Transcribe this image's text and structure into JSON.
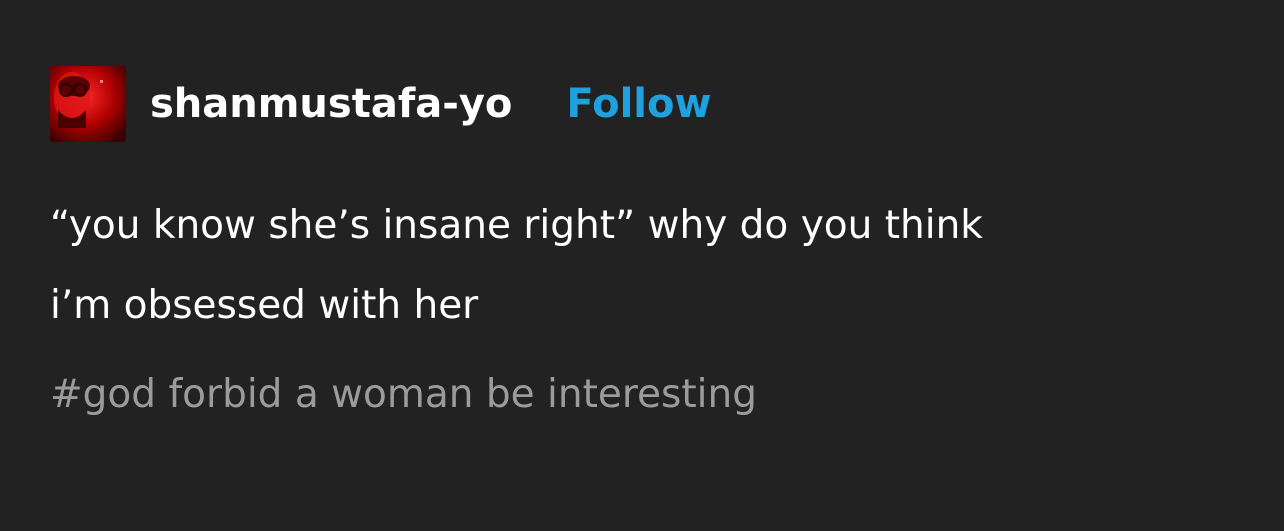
{
  "post": {
    "username": "shanmustafa-yo",
    "follow_label": "Follow",
    "body_line_1": "“you know she’s insane right” why do you think",
    "body_line_2": "i’m obsessed with her",
    "tags": [
      "#god forbid a woman be interesting"
    ]
  },
  "colors": {
    "background": "#222222",
    "text": "#ffffff",
    "follow": "#1ea1de",
    "tag": "#9b9b9b"
  },
  "icons": {
    "avatar": "user-avatar"
  }
}
